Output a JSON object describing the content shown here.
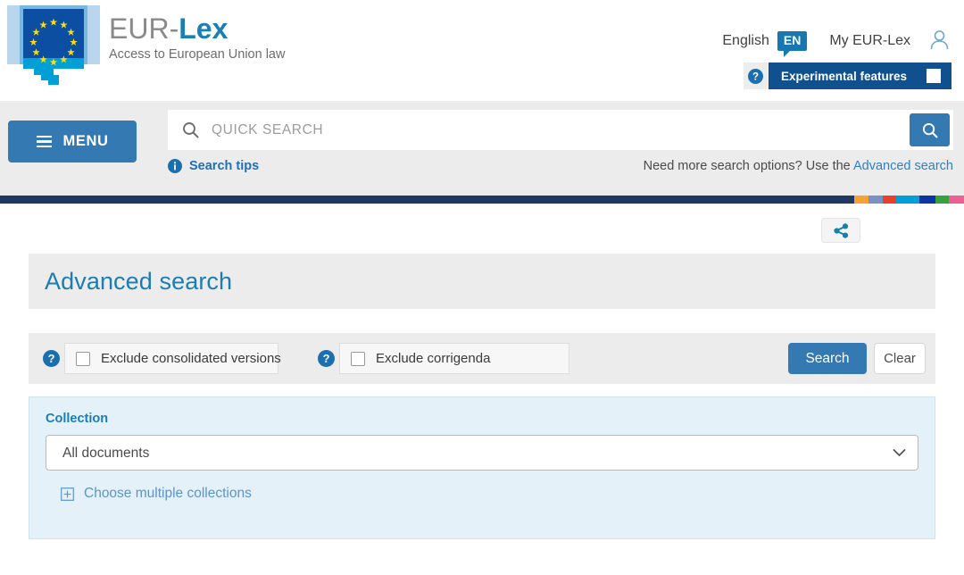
{
  "header": {
    "brand_name_prefix": "EUR-",
    "brand_name_suffix": "Lex",
    "tagline": "Access to European Union law",
    "language_label": "English",
    "language_code": "EN",
    "my_account_label": "My EUR-Lex",
    "experimental_label": "Experimental features",
    "logo_icon": "eu-flag-speech-bubble-icon",
    "avatar_icon": "user-avatar-icon",
    "help_icon": "question-mark-circle-icon"
  },
  "search_strip": {
    "menu_label": "MENU",
    "menu_icon": "hamburger-icon",
    "quick_search_placeholder": "QUICK SEARCH",
    "quick_search_value": "",
    "search_icon": "magnifier-icon",
    "submit_icon": "magnifier-icon",
    "tips_icon": "info-circle-icon",
    "tips_label": "Search tips",
    "advanced_prompt": "Need more search options? Use the ",
    "advanced_link": "Advanced search"
  },
  "stripe_colors": [
    "#1f3864",
    "#f9a034",
    "#7b8fc4",
    "#e8402a",
    "#00a0d6",
    "#0b35a5",
    "#37a041",
    "#ec5f95"
  ],
  "toolbar": {
    "share_label": "Share",
    "share_icon": "share-nodes-icon"
  },
  "page": {
    "title": "Advanced search"
  },
  "filters": {
    "exclude_consolidated": {
      "label": "Exclude consolidated versions",
      "checked": false,
      "help_icon": "question-mark-circle-icon"
    },
    "exclude_corrigenda": {
      "label": "Exclude corrigenda",
      "checked": false,
      "help_icon": "question-mark-circle-icon"
    },
    "search_button": "Search",
    "clear_button": "Clear"
  },
  "collection": {
    "legend": "Collection",
    "selected": "All documents",
    "options": [
      "All documents"
    ],
    "chevron_icon": "chevron-down-icon",
    "multi_link_label": "Choose multiple collections",
    "multi_link_icon": "plus-square-icon"
  }
}
